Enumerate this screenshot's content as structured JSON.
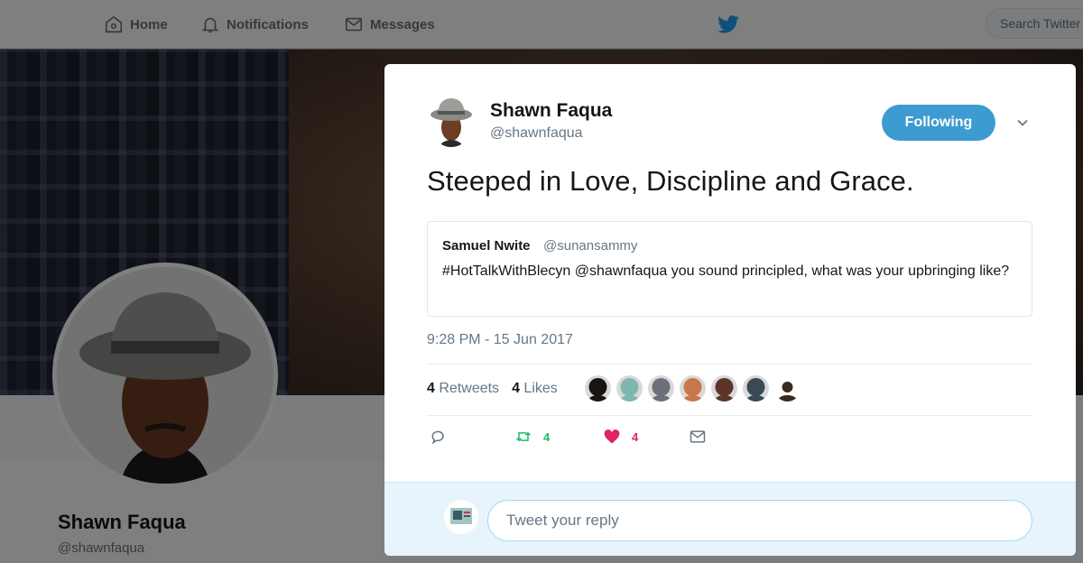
{
  "nav": {
    "home_label": "Home",
    "notifications_label": "Notifications",
    "messages_label": "Messages",
    "search_placeholder": "Search Twitter"
  },
  "profile": {
    "name": "Shawn Faqua",
    "handle": "@shawnfaqua"
  },
  "tweet": {
    "author_name": "Shawn Faqua",
    "author_handle": "@shawnfaqua",
    "follow_label": "Following",
    "text": "Steeped in Love, Discipline and Grace.",
    "quoted": {
      "name": "Samuel Nwite",
      "handle": "@sunansammy",
      "text": "#HotTalkWithBlecyn @shawnfaqua you sound principled, what was your upbringing like?"
    },
    "timestamp": "9:28 PM - 15 Jun 2017",
    "stats": {
      "retweets_count": "4",
      "retweets_label": "Retweets",
      "likes_count": "4",
      "likes_label": "Likes"
    },
    "likers": [
      {
        "name": "liker-1",
        "color": "#1a1410"
      },
      {
        "name": "liker-2",
        "color": "#7fb7b0"
      },
      {
        "name": "liker-3",
        "color": "#6d6f79"
      },
      {
        "name": "liker-4",
        "color": "#c9774b"
      },
      {
        "name": "liker-5",
        "color": "#5a3528"
      },
      {
        "name": "liker-6",
        "color": "#3a4a55"
      },
      {
        "name": "liker-7",
        "color": "#3b2a1e"
      }
    ],
    "actions": {
      "retweet_count": "4",
      "like_count": "4"
    }
  },
  "reply": {
    "placeholder": "Tweet your reply"
  },
  "colors": {
    "accent": "#3d9bd1",
    "retweet": "#17bf63",
    "like": "#e0245e",
    "muted": "#657786"
  }
}
